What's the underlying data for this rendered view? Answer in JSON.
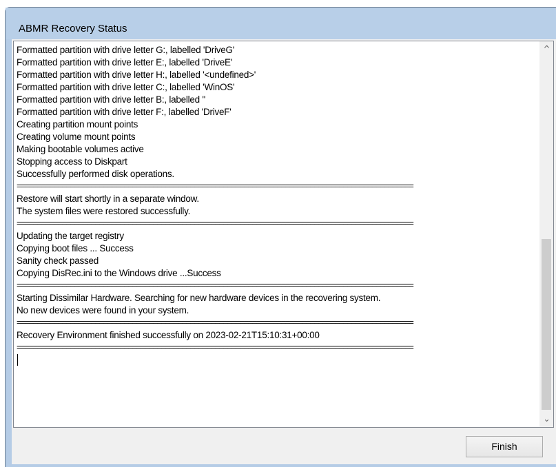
{
  "window": {
    "title": "ABMR Recovery Status"
  },
  "log": {
    "lines": [
      {
        "text": "Formatted partition with drive letter G:, labelled 'DriveG'",
        "type": "text"
      },
      {
        "text": "Formatted partition with drive letter E:, labelled 'DriveE'",
        "type": "text"
      },
      {
        "text": "Formatted partition with drive letter H:, labelled '<undefined>'",
        "type": "text"
      },
      {
        "text": "Formatted partition with drive letter C:, labelled 'WinOS'",
        "type": "text"
      },
      {
        "text": "Formatted partition with drive letter B:, labelled ''",
        "type": "text"
      },
      {
        "text": "Formatted partition with drive letter F:, labelled 'DriveF'",
        "type": "text"
      },
      {
        "text": "Creating partition mount points",
        "type": "text"
      },
      {
        "text": "Creating volume mount points",
        "type": "text"
      },
      {
        "text": "Making bootable volumes active",
        "type": "text"
      },
      {
        "text": "Stopping access to Diskpart",
        "type": "text"
      },
      {
        "text": "Successfully performed disk operations.",
        "type": "text"
      },
      {
        "text": "================================================================================================",
        "type": "sep"
      },
      {
        "text": "Restore will start shortly in a separate window.",
        "type": "text"
      },
      {
        "text": "The system files were restored successfully.",
        "type": "text"
      },
      {
        "text": "================================================================================================",
        "type": "sep"
      },
      {
        "text": "Updating the target registry",
        "type": "text"
      },
      {
        "text": "Copying boot files ... Success",
        "type": "text"
      },
      {
        "text": "Sanity check passed",
        "type": "text"
      },
      {
        "text": "Copying DisRec.ini to the Windows drive ...Success",
        "type": "text"
      },
      {
        "text": "================================================================================================",
        "type": "sep"
      },
      {
        "text": "Starting Dissimilar Hardware. Searching for new hardware devices in the recovering system.",
        "type": "text"
      },
      {
        "text": "No new devices were found in your system.",
        "type": "text"
      },
      {
        "text": "================================================================================================",
        "type": "sep"
      },
      {
        "text": "Recovery Environment finished successfully on 2023-02-21T15:10:31+00:00",
        "type": "text"
      },
      {
        "text": "================================================================================================",
        "type": "sep"
      }
    ],
    "scroll_up_icon": "chevron-up-icon",
    "scroll_down_icon": "chevron-down-icon",
    "scroll_up_glyph": "^",
    "scroll_down_glyph": "⌄"
  },
  "buttons": {
    "finish_label": "Finish"
  }
}
